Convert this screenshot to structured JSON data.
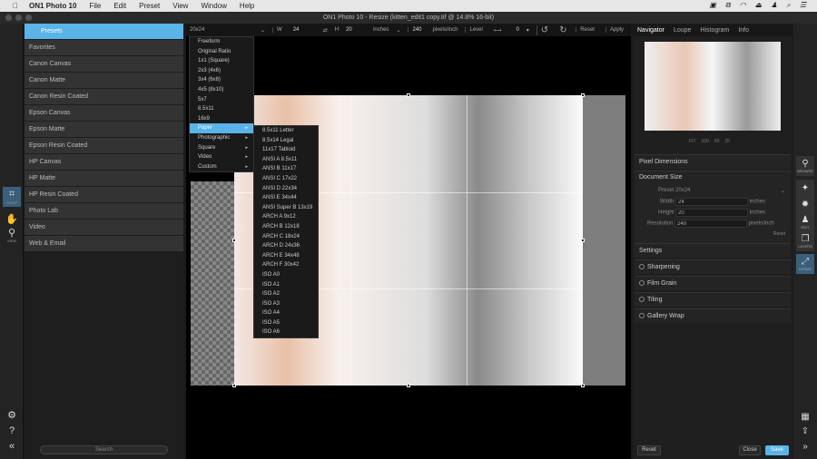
{
  "menubar": {
    "app": "ON1 Photo 10",
    "items": [
      "File",
      "Edit",
      "Preset",
      "View",
      "Window",
      "Help"
    ]
  },
  "window_title": "ON1 Photo 10 - Resize (kitten_edit1 copy.tif @ 14.8% 16-bit)",
  "left_tools": [
    {
      "label": "CROP"
    },
    {
      "label": "VIEW"
    }
  ],
  "presets": [
    "Presets",
    "Favorites",
    "Canon Canvas",
    "Canon Matte",
    "Canon Resin Coated",
    "Epson Canvas",
    "Epson Matte",
    "Epson Resin Coated",
    "HP Canvas",
    "HP Matte",
    "HP Resin Coated",
    "Photo Lab",
    "Video",
    "Web & Email"
  ],
  "search_label": "Search",
  "toolbar": {
    "preset": "20x24",
    "w_label": "W",
    "w": "24",
    "h_label": "H",
    "h": "20",
    "unit": "inches",
    "res": "240",
    "res_unit": "pixels/inch",
    "level": "Level",
    "rotate": "0",
    "reset": "Reset",
    "apply": "Apply"
  },
  "crop_menu": [
    {
      "label": "Freeform"
    },
    {
      "label": "Original Ratio"
    },
    {
      "label": "1x1 (Square)"
    },
    {
      "label": "2x3 (4x6)"
    },
    {
      "label": "3x4 (6x8)"
    },
    {
      "label": "4x5 (8x10)"
    },
    {
      "label": "5x7"
    },
    {
      "label": "8.5x11"
    },
    {
      "label": "16x9"
    },
    {
      "label": "Paper",
      "sub": true
    },
    {
      "label": "Photographic",
      "sub": true
    },
    {
      "label": "Square",
      "sub": true
    },
    {
      "label": "Video",
      "sub": true
    },
    {
      "label": "Custom",
      "sub": true
    }
  ],
  "paper_menu": [
    "8.5x11 Letter",
    "8.5x14 Legal",
    "11x17 Tabloid",
    "ANSI A 8.5x11",
    "ANSI B 11x17",
    "ANSI C 17x22",
    "ANSI D 22x34",
    "ANSI E 34x44",
    "ANSI Super B 13x19",
    "ARCH A 9x12",
    "ARCH B 12x18",
    "ARCH C 18x24",
    "ARCH D 24x36",
    "ARCH E 34x48",
    "ARCH F 30x42",
    "ISO A0",
    "ISO A1",
    "ISO A2",
    "ISO A3",
    "ISO A4",
    "ISO A5",
    "ISO A6"
  ],
  "right": {
    "tabs": [
      "Navigator",
      "Loupe",
      "Histogram",
      "Info"
    ],
    "zoom": [
      "FIT",
      "100",
      "50",
      "25"
    ],
    "pixel_dimensions": "Pixel Dimensions",
    "document_size": "Document Size",
    "preset_label": "Preset",
    "preset": "20x24",
    "width_label": "Width",
    "width": "24",
    "height_label": "Height",
    "height": "20",
    "unit": "inches",
    "res_label": "Resolution",
    "res": "240",
    "res_unit": "pixels/inch",
    "reset": "Reset",
    "settings": "Settings",
    "options": [
      "Sharpening",
      "Film Grain",
      "Tiling",
      "Gallery Wrap"
    ]
  },
  "right_tools": [
    "BROWSE",
    "EDIT",
    "LAYERS",
    "RESIZE"
  ],
  "bottom": {
    "reset": "Reset",
    "close": "Close",
    "save": "Save"
  },
  "colors": {
    "accent": "#5ab4e8"
  }
}
